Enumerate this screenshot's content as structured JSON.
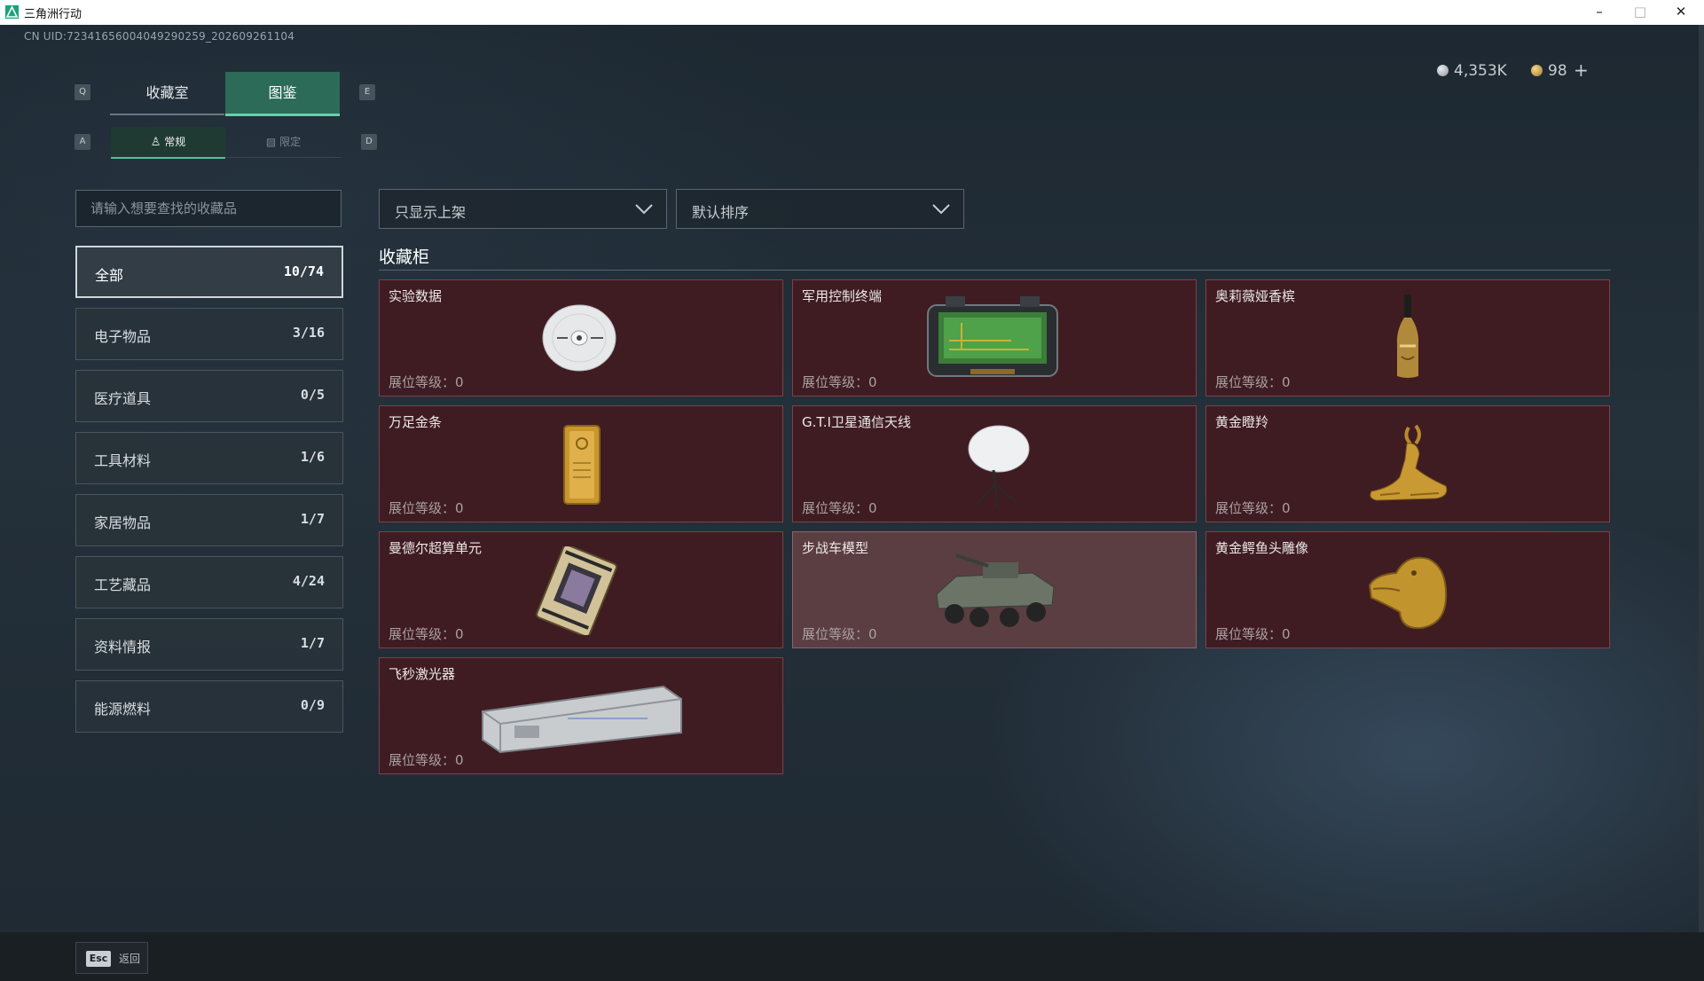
{
  "window": {
    "title": "三角洲行动",
    "controls": [
      "–",
      "□",
      "✕"
    ]
  },
  "uid": "CN UID:72341656004049290259_202609261104",
  "currency": {
    "silver": "4,353K",
    "gold": "98",
    "add": "+"
  },
  "main_tabs": {
    "key_left": "Q",
    "key_right": "E",
    "tabs": [
      {
        "label": "收藏室"
      },
      {
        "label": "图鉴"
      }
    ]
  },
  "sub_tabs": {
    "key_left": "A",
    "key_right": "D",
    "tabs": [
      {
        "label": "常规"
      },
      {
        "label": "限定"
      }
    ]
  },
  "search": {
    "placeholder": "请输入想要查找的收藏品"
  },
  "categories": [
    {
      "label": "全部",
      "count": "10/74"
    },
    {
      "label": "电子物品",
      "count": "3/16"
    },
    {
      "label": "医疗道具",
      "count": "0/5"
    },
    {
      "label": "工具材料",
      "count": "1/6"
    },
    {
      "label": "家居物品",
      "count": "1/7"
    },
    {
      "label": "工艺藏品",
      "count": "4/24"
    },
    {
      "label": "资料情报",
      "count": "1/7"
    },
    {
      "label": "能源燃料",
      "count": "0/9"
    }
  ],
  "filters": {
    "shelf": "只显示上架",
    "sort": "默认排序"
  },
  "section_title": "收藏柜",
  "items": [
    {
      "name": "实验数据",
      "level": "展位等级：0",
      "icon": "cd-disc-icon"
    },
    {
      "name": "军用控制终端",
      "level": "展位等级：0",
      "icon": "control-terminal-icon"
    },
    {
      "name": "奥莉薇娅香槟",
      "level": "展位等级：0",
      "icon": "champagne-bottle-icon"
    },
    {
      "name": "万足金条",
      "level": "展位等级：0",
      "icon": "gold-bar-icon"
    },
    {
      "name": "G.T.I卫星通信天线",
      "level": "展位等级：0",
      "icon": "satellite-dish-icon"
    },
    {
      "name": "黄金瞪羚",
      "level": "展位等级：0",
      "icon": "golden-gazelle-icon"
    },
    {
      "name": "曼德尔超算单元",
      "level": "展位等级：0",
      "icon": "compute-unit-icon"
    },
    {
      "name": "步战车模型",
      "level": "展位等级：0",
      "icon": "ifv-model-icon"
    },
    {
      "name": "黄金鳄鱼头雕像",
      "level": "展位等级：0",
      "icon": "golden-crocodile-icon"
    },
    {
      "name": "飞秒激光器",
      "level": "展位等级：0",
      "icon": "femtosecond-laser-icon"
    }
  ],
  "footer": {
    "key": "Esc",
    "label": "返回"
  },
  "colors": {
    "accent": "#5fd3ad",
    "card_bg": "#3f1c22",
    "card_highlight": "#5b3e42"
  }
}
